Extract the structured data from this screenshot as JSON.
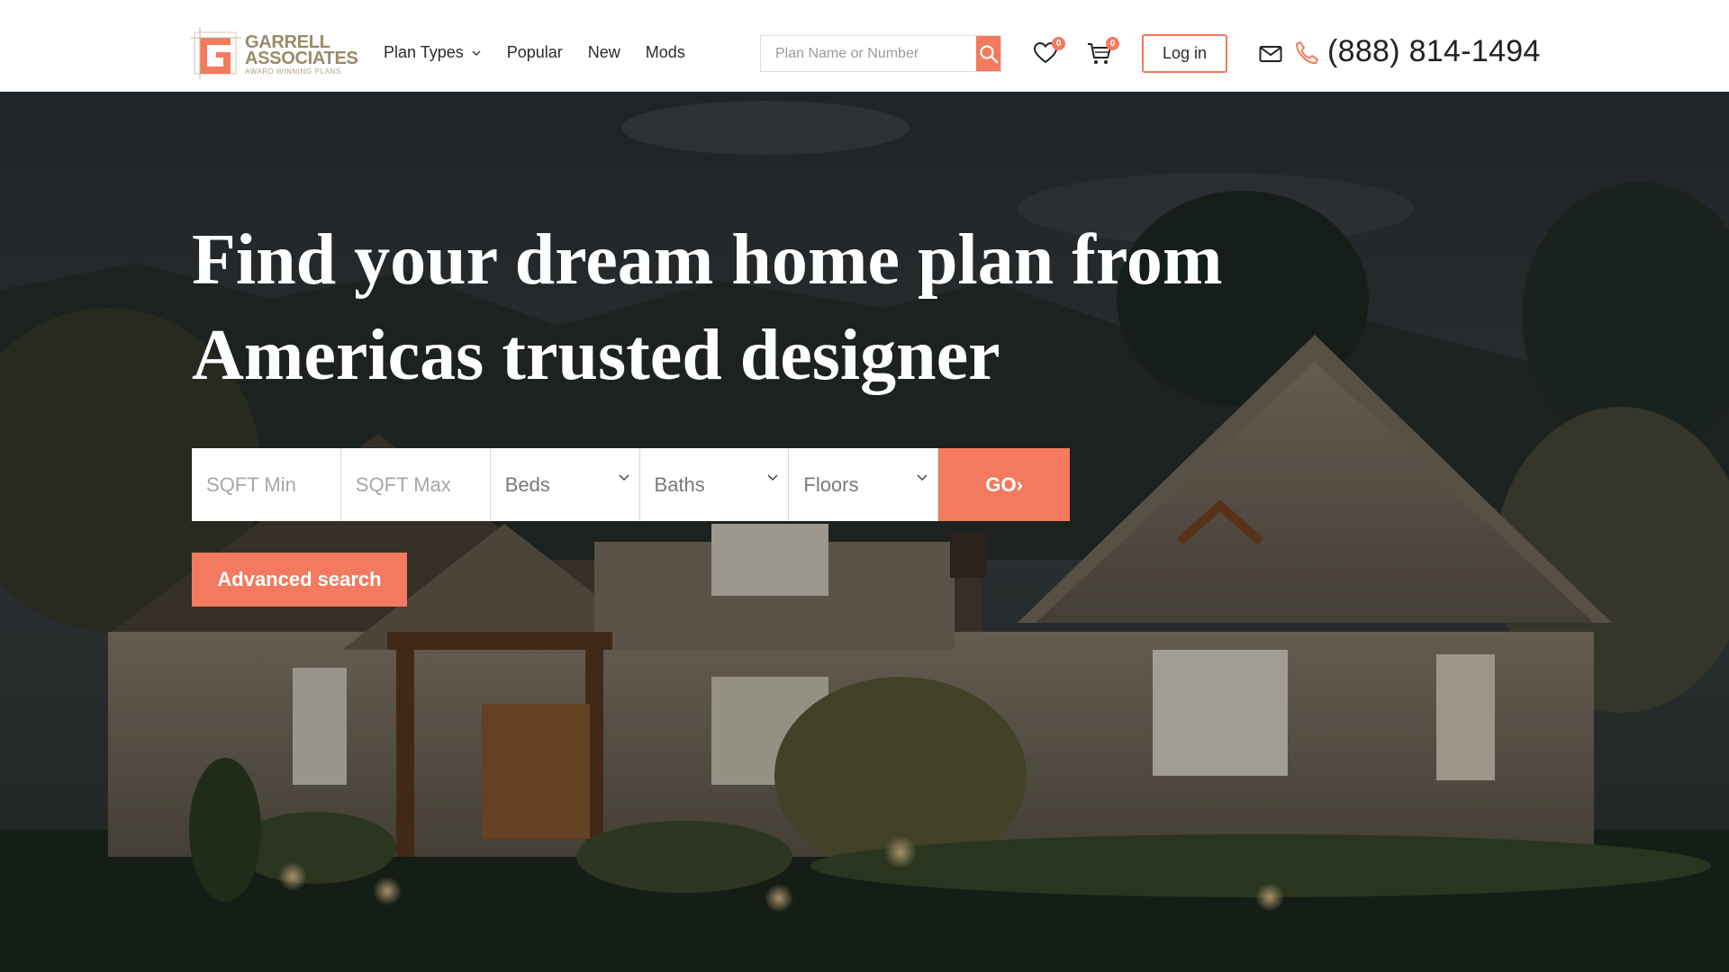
{
  "brand": {
    "name_line1": "GARRELL",
    "name_line2": "ASSOCIATES",
    "tagline": "AWARD WINNING PLANS",
    "accent": "#f37a5e",
    "logo_color": "#9a8a6a"
  },
  "nav": {
    "items": [
      {
        "label": "Plan Types",
        "has_dropdown": true
      },
      {
        "label": "Popular",
        "has_dropdown": false
      },
      {
        "label": "New",
        "has_dropdown": false
      },
      {
        "label": "Mods",
        "has_dropdown": false
      }
    ]
  },
  "search": {
    "placeholder": "Plan Name or Number",
    "value": "",
    "icon": "search-icon"
  },
  "header_icons": {
    "favorites": {
      "icon": "heart-icon",
      "count": "0"
    },
    "cart": {
      "icon": "cart-icon",
      "count": "0"
    }
  },
  "auth": {
    "login_label": "Log in"
  },
  "contact": {
    "mail_icon": "mail-icon",
    "phone_icon": "phone-icon",
    "phone": "(888) 814-1494"
  },
  "hero": {
    "headline_line1": "Find your dream home plan from",
    "headline_line2": "Americas trusted designer",
    "filters": {
      "sqft_min_placeholder": "SQFT Min",
      "sqft_max_placeholder": "SQFT Max",
      "beds_label": "Beds",
      "baths_label": "Baths",
      "floors_label": "Floors",
      "go_label": "GO›"
    },
    "advanced_search_label": "Advanced search"
  }
}
